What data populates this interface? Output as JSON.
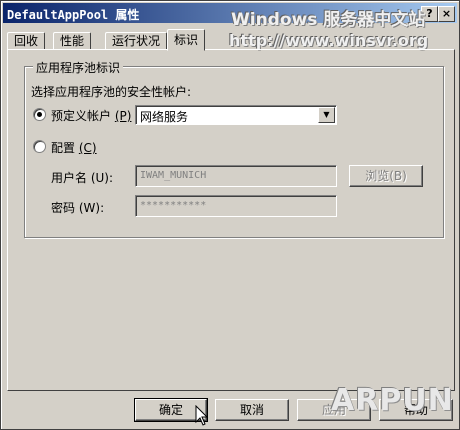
{
  "window": {
    "title_en": "DefaultAppPool",
    "title_cn": "属性",
    "help_btn": "?",
    "close_btn": "×"
  },
  "watermark": {
    "line1": "Windows 服务器中文站",
    "line2": "http://www.winsvr.org",
    "corner": "ARPUN"
  },
  "tabs": [
    "回收",
    "性能",
    "运行状况",
    "标识"
  ],
  "group": {
    "legend": "应用程序池标识",
    "prompt": "选择应用程序池的安全性帐户:",
    "predefined_label": "预定义帐户",
    "predefined_key": "(P)",
    "predefined_value": "网络服务",
    "config_label": "配置",
    "config_key": "(C)",
    "username_label": "用户名",
    "username_key": "(U):",
    "username_value": "IWAM_MUNICH",
    "browse_label": "浏览",
    "browse_key": "(B)",
    "password_label": "密码",
    "password_key": "(W):",
    "password_value": "***********"
  },
  "buttons": {
    "ok": "确定",
    "cancel": "取消",
    "apply": "应用",
    "help": "帮助"
  }
}
